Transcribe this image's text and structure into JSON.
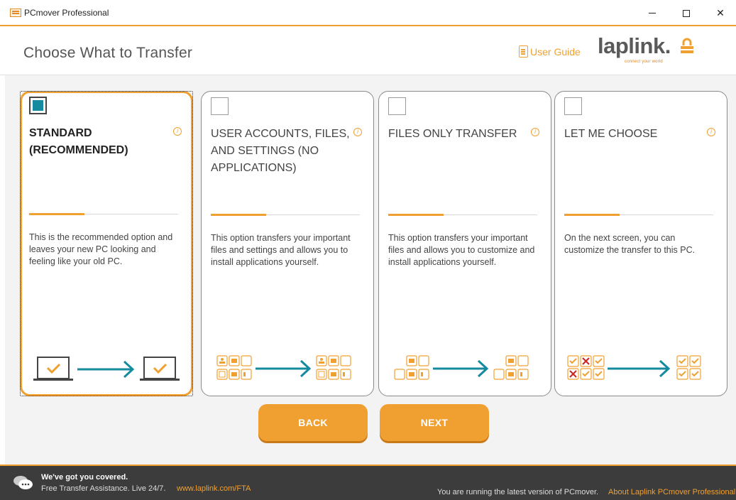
{
  "window": {
    "title": "PCmover Professional"
  },
  "header": {
    "page_title": "Choose What to Transfer",
    "user_guide": "User Guide",
    "logo_text": "laplink.",
    "logo_tagline": "connect your world"
  },
  "cards": [
    {
      "title": "STANDARD (RECOMMENDED)",
      "description": "This is the recommended option and leaves your new PC looking and feeling like your old PC.",
      "checked": true
    },
    {
      "title": "USER ACCOUNTS, FILES, AND SETTINGS (NO APPLICATIONS)",
      "description": "This option transfers your important files and settings and allows you to install applications yourself.",
      "checked": false
    },
    {
      "title": "FILES ONLY TRANSFER",
      "description": "This option transfers your important files and allows you to customize and install applications yourself.",
      "checked": false
    },
    {
      "title": "LET ME CHOOSE",
      "description": "On the next screen, you can customize the transfer to this PC.",
      "checked": false
    }
  ],
  "buttons": {
    "back": "BACK",
    "next": "NEXT"
  },
  "footer": {
    "headline": "We've got you covered.",
    "subtext": "Free Transfer Assistance. Live 24/7.",
    "link": "www.laplink.com/FTA",
    "status": "You are running the latest version of PCmover.",
    "about": "About Laplink PCmover Professional"
  },
  "colors": {
    "accent": "#f0a030",
    "teal": "#168a9e",
    "error": "#cc2a2a"
  }
}
